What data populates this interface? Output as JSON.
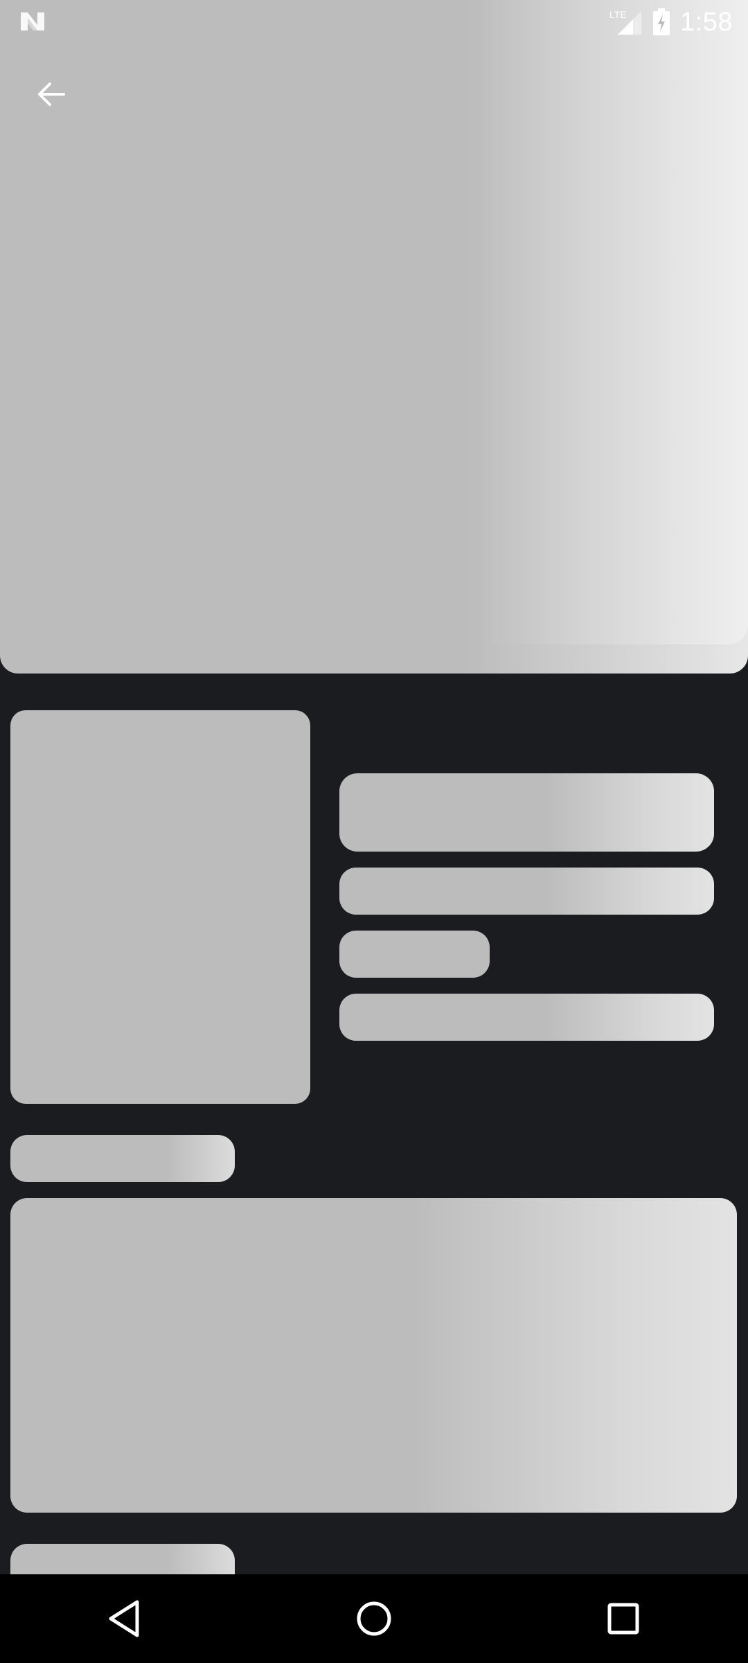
{
  "status_bar": {
    "time": "1:58",
    "network_label": "LTE",
    "icons": [
      "notification-n-icon",
      "lte-signal-icon",
      "battery-charging-icon"
    ]
  },
  "toolbar": {
    "back_icon": "arrow-left-icon"
  },
  "content_state": "loading-skeleton",
  "skeleton": {
    "blocks": [
      "hero-backdrop",
      "poster",
      "title",
      "meta-line-1",
      "meta-line-2",
      "meta-line-3",
      "section-label",
      "overview",
      "section-label"
    ],
    "base_color": "#bcbcbc",
    "highlight_color": "#e6e6e6"
  },
  "navigation_bar": {
    "buttons": [
      "back-triangle-icon",
      "home-circle-icon",
      "recents-square-icon"
    ]
  },
  "colors": {
    "background": "#1a1c20",
    "nav_background": "#000000",
    "icon": "#ffffff"
  }
}
